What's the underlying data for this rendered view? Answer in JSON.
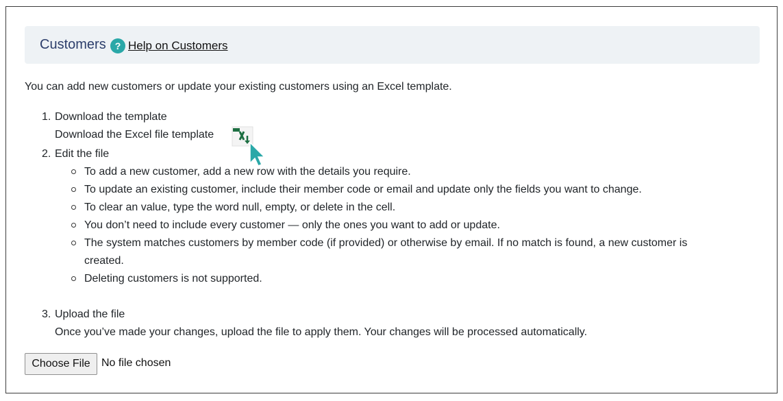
{
  "header": {
    "title": "Customers",
    "help_icon_glyph": "?",
    "help_link": "Help on Customers"
  },
  "intro": "You can add new customers or update your existing customers using an Excel template.",
  "steps": [
    {
      "number": "1.",
      "title": "Download the template",
      "detail": "Download the Excel file template",
      "icon": "excel-download-icon"
    },
    {
      "number": "2.",
      "title": "Edit the file",
      "bullets": [
        "To add a new customer, add a new row with the details you require.",
        "To update an existing customer, include their member code or email and update only the fields you want to change.",
        "To clear an value, type the word null, empty, or delete in the cell.",
        "You don’t need to include every customer — only the ones you want to add or update.",
        "The system matches customers by member code (if provided) or otherwise by email. If no match is found, a new customer is",
        "created.",
        "Deleting customers is not supported."
      ]
    },
    {
      "number": "3.",
      "title": "Upload the file",
      "detail": "Once you’ve made your changes, upload the file to apply them. Your changes will be processed automatically."
    }
  ],
  "file_input": {
    "button_label": "Choose File",
    "status": "No file chosen"
  },
  "colors": {
    "header_bg": "#eef2f5",
    "title_color": "#2c3e6b",
    "accent_teal": "#2aa8a8",
    "excel_green": "#1d6f42"
  }
}
